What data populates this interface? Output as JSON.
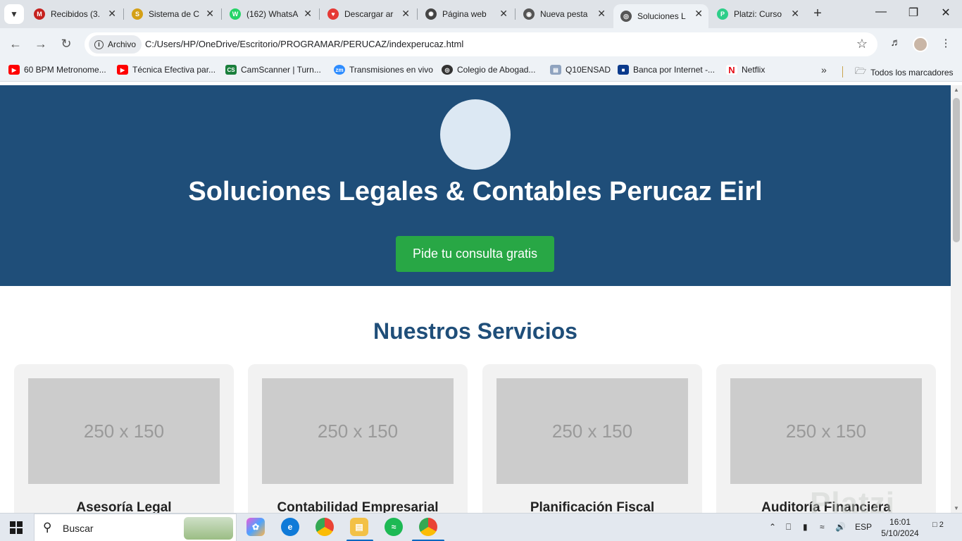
{
  "browser": {
    "tabs": [
      {
        "label": "Recibidos (3.",
        "icon": "gmail-icon",
        "color": "#c5221f"
      },
      {
        "label": "Sistema de C",
        "icon": "sistema-icon",
        "color": "#d4a017"
      },
      {
        "label": "(162) WhatsA",
        "icon": "whatsapp-icon",
        "color": "#25d366"
      },
      {
        "label": "Descargar ar",
        "icon": "download-icon",
        "color": "#e53935"
      },
      {
        "label": "Página web",
        "icon": "chatgpt-icon",
        "color": "#444444"
      },
      {
        "label": "Nueva pesta",
        "icon": "chrome-icon",
        "color": "#555555"
      },
      {
        "label": "Soluciones L",
        "icon": "globe-icon",
        "color": "#555555",
        "active": true
      },
      {
        "label": "Platzi: Curso",
        "icon": "platzi-icon",
        "color": "#2dce89"
      }
    ],
    "address_chip": "Archivo",
    "url": "C:/Users/HP/OneDrive/Escritorio/PROGRAMAR/PERUCAZ/indexperucaz.html",
    "bookmarks": [
      {
        "label": "60 BPM Metronome...",
        "color": "#ff0000"
      },
      {
        "label": "Técnica Efectiva par...",
        "color": "#ff0000"
      },
      {
        "label": "CamScanner | Turn...",
        "color": "#1a7f3c"
      },
      {
        "label": "Transmisiones en vivo",
        "color": "#2d8cff"
      },
      {
        "label": "Colegio de Abogad...",
        "color": "#333333"
      },
      {
        "label": "Q10ENSAD",
        "color": "#8fa3bf"
      },
      {
        "label": "Banca por Internet -...",
        "color": "#0b3a8c"
      },
      {
        "label": "Netflix",
        "color": "#e50914"
      }
    ],
    "all_bookmarks": "Todos los marcadores"
  },
  "page": {
    "hero_title": "Soluciones Legales & Contables Perucaz Eirl",
    "cta_label": "Pide tu consulta gratis",
    "services_title": "Nuestros Servicios",
    "services": [
      {
        "placeholder": "250 x 150",
        "title": "Asesoría Legal"
      },
      {
        "placeholder": "250 x 150",
        "title": "Contabilidad Empresarial"
      },
      {
        "placeholder": "250 x 150",
        "title": "Planificación Fiscal"
      },
      {
        "placeholder": "250 x 150",
        "title": "Auditoría Financiera"
      }
    ],
    "colors": {
      "hero": "#1f4e79",
      "cta": "#28a745",
      "card": "#f2f2f2"
    }
  },
  "watermark": "Platzi",
  "taskbar": {
    "search_label": "Buscar",
    "language": "ESP",
    "time": "16:01",
    "date": "5/10/2024",
    "notifications": "2"
  }
}
